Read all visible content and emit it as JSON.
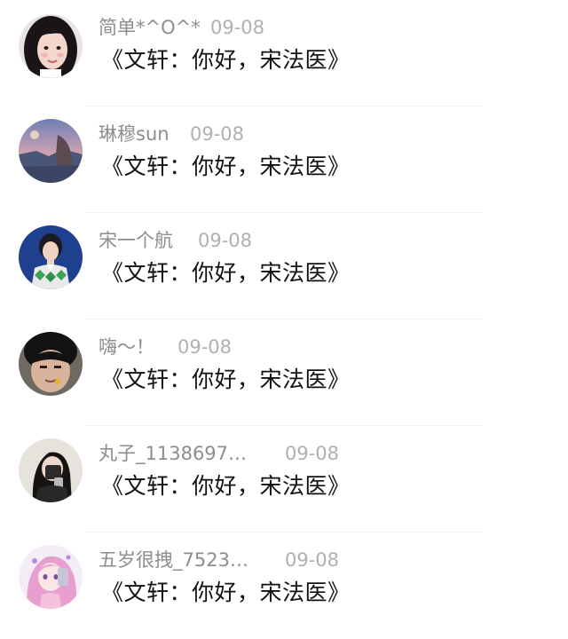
{
  "comments": [
    {
      "username": "简单*^O^*",
      "date": "09-08",
      "text": "《文轩：你好，宋法医》",
      "avatar_icon": "girl-avatar-icon"
    },
    {
      "username": "琳穆sun",
      "date": "09-08",
      "text": "《文轩：你好，宋法医》",
      "avatar_icon": "landscape-avatar-icon"
    },
    {
      "username": "宋一个航",
      "date": "09-08",
      "text": "《文轩：你好，宋法医》",
      "avatar_icon": "boy-sweater-avatar-icon"
    },
    {
      "username": "嗨～！",
      "date": "09-08",
      "text": "《文轩：你好，宋法医》",
      "avatar_icon": "boy-selfie-avatar-icon"
    },
    {
      "username": "丸子_1138697…",
      "date": "09-08",
      "text": "《文轩：你好，宋法医》",
      "avatar_icon": "mirror-selfie-avatar-icon"
    },
    {
      "username": "五岁很拽_7523…",
      "date": "09-08",
      "text": "《文轩：你好，宋法医》",
      "avatar_icon": "anime-girl-avatar-icon"
    }
  ],
  "colors": {
    "username": "#8d8d8d",
    "date": "#b0b0b0",
    "content": "#111111",
    "divider": "#f0f0f0"
  }
}
